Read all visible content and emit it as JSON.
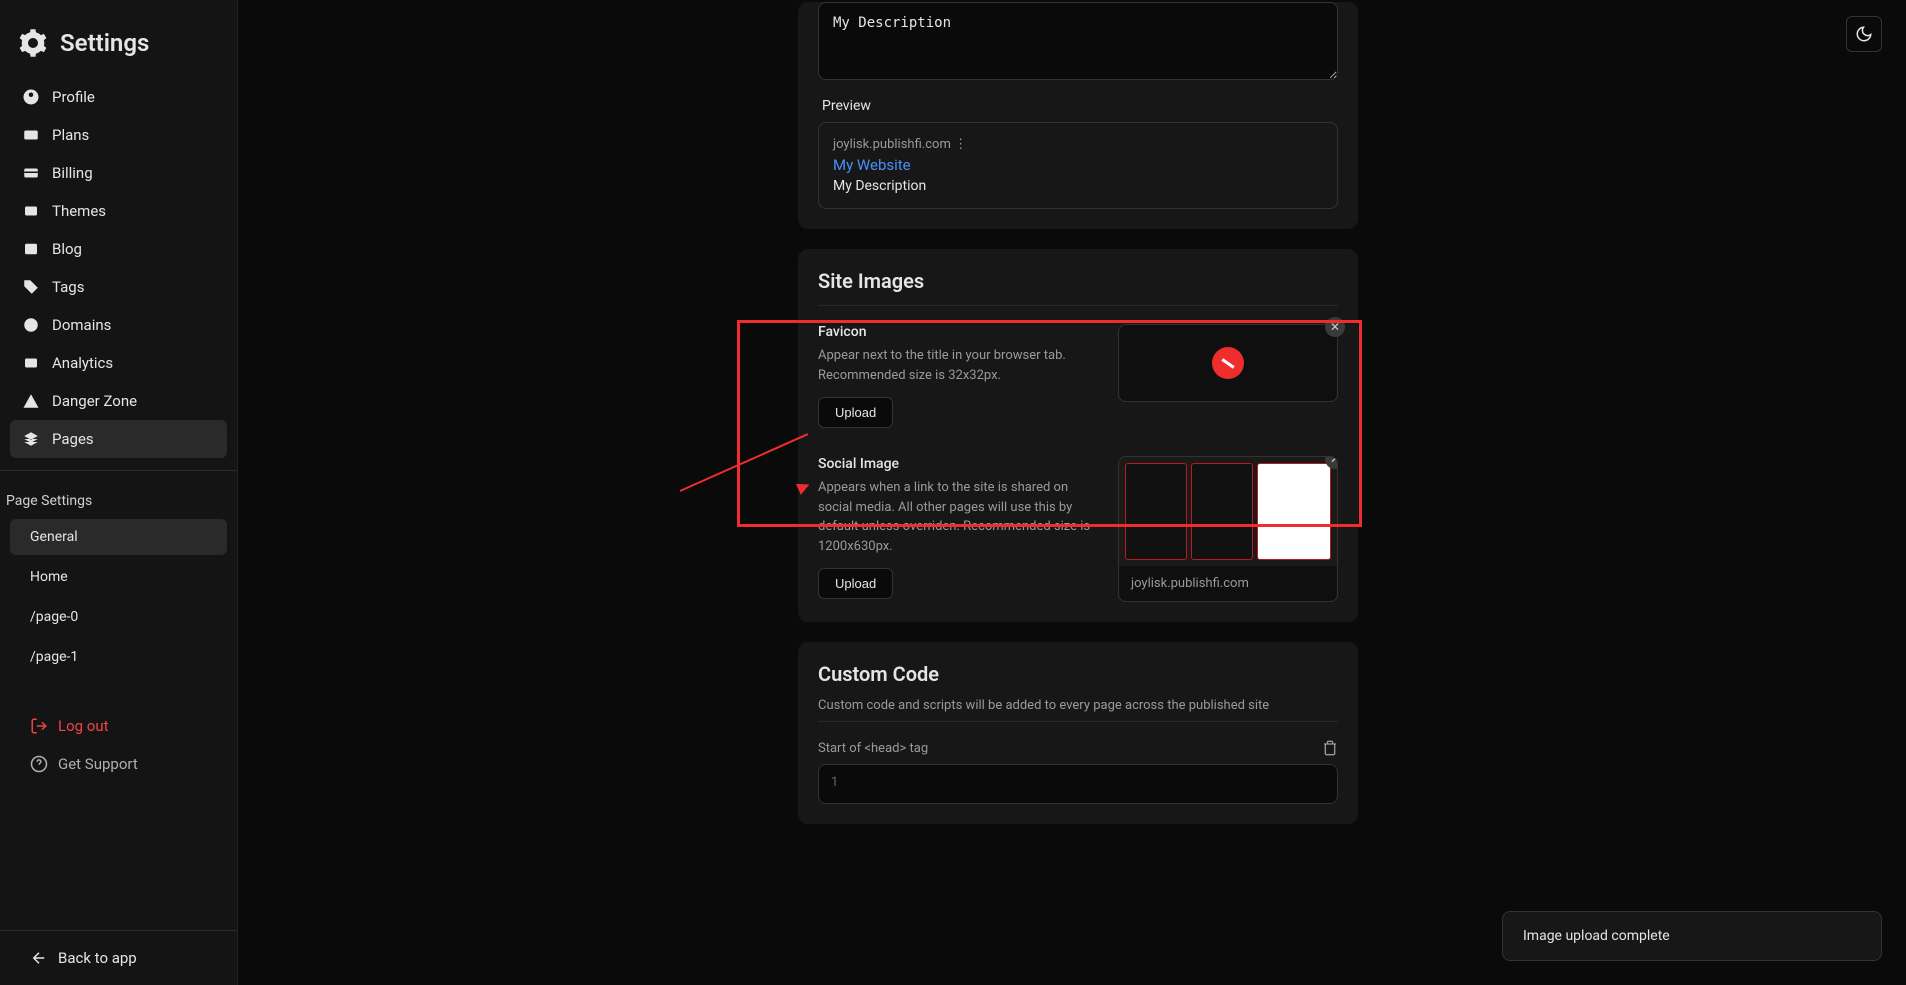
{
  "sidebar": {
    "title": "Settings",
    "nav": [
      {
        "label": "Profile"
      },
      {
        "label": "Plans"
      },
      {
        "label": "Billing"
      },
      {
        "label": "Themes"
      },
      {
        "label": "Blog"
      },
      {
        "label": "Tags"
      },
      {
        "label": "Domains"
      },
      {
        "label": "Analytics"
      },
      {
        "label": "Danger Zone"
      },
      {
        "label": "Pages"
      }
    ],
    "page_settings_label": "Page Settings",
    "pages": [
      {
        "label": "General"
      },
      {
        "label": "Home"
      },
      {
        "label": "/page-0"
      },
      {
        "label": "/page-1"
      }
    ],
    "logout": "Log out",
    "support": "Get Support",
    "back": "Back to app"
  },
  "description_value": "My Description",
  "preview": {
    "label": "Preview",
    "url": "joylisk.publishfi.com ⋮",
    "title": "My Website",
    "desc": "My Description"
  },
  "site_images": {
    "title": "Site Images",
    "favicon": {
      "title": "Favicon",
      "desc": "Appear next to the title in your browser tab. Recommended size is 32x32px.",
      "upload": "Upload"
    },
    "social": {
      "title": "Social Image",
      "desc": "Appears when a link to the site is shared on social media. All other pages will use this by default unless overriden. Recommended size is 1200x630px.",
      "upload": "Upload",
      "url": "joylisk.publishfi.com"
    }
  },
  "custom_code": {
    "title": "Custom Code",
    "subtitle": "Custom code and scripts will be added to every page across the published site",
    "head_label": "Start of <head> tag",
    "line_no": "1"
  },
  "toast": "Image upload complete"
}
